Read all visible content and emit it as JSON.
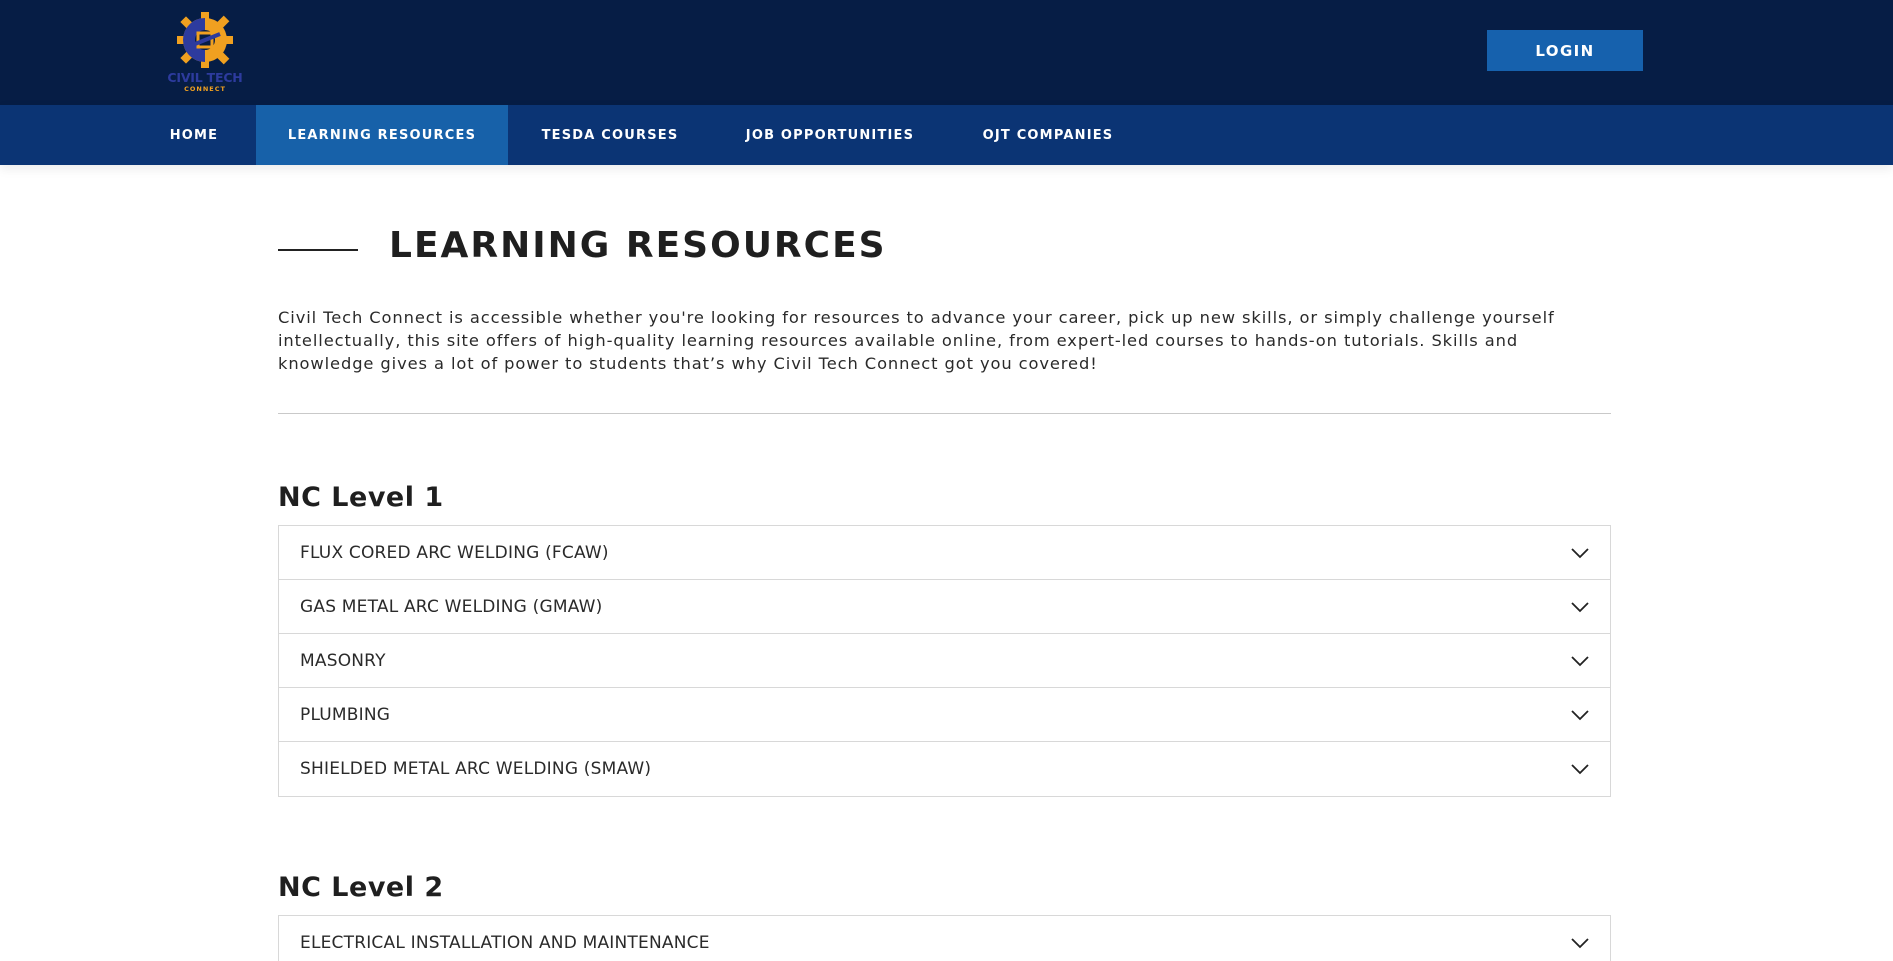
{
  "header": {
    "logo_text": "CIVIL TECH",
    "logo_sub": "CONNECT",
    "login_label": "LOGIN"
  },
  "nav": {
    "items": [
      {
        "label": "HOME"
      },
      {
        "label": "LEARNING RESOURCES",
        "active": true
      },
      {
        "label": "TESDA COURSES"
      },
      {
        "label": "JOB OPPORTUNITIES"
      },
      {
        "label": "OJT COMPANIES"
      }
    ]
  },
  "main": {
    "title": "LEARNING RESOURCES",
    "intro": "Civil Tech Connect is accessible whether you're looking for resources to advance your career, pick up new skills, or simply challenge yourself intellectually, this site offers of high-quality learning resources available online, from expert-led courses to hands-on tutorials. Skills and knowledge gives a lot of power to students that’s why Civil Tech Connect got you covered!",
    "levels": [
      {
        "title": "NC Level 1",
        "items": [
          "FLUX CORED ARC WELDING (FCAW)",
          "GAS METAL ARC WELDING (GMAW)",
          "MASONRY",
          "PLUMBING",
          "SHIELDED METAL ARC WELDING (SMAW)"
        ]
      },
      {
        "title": "NC Level 2",
        "items": [
          "ELECTRICAL INSTALLATION AND MAINTENANCE"
        ]
      }
    ]
  },
  "icons": {
    "chevron": "chevron-down-icon",
    "logo": "gear-logo-icon"
  },
  "colors": {
    "topbar": "#061d45",
    "navbar": "#0b3474",
    "nav_active": "#1761a9",
    "login_button": "#1661ad",
    "logo_orange": "#f0a020",
    "logo_blue": "#2d3b9e"
  }
}
